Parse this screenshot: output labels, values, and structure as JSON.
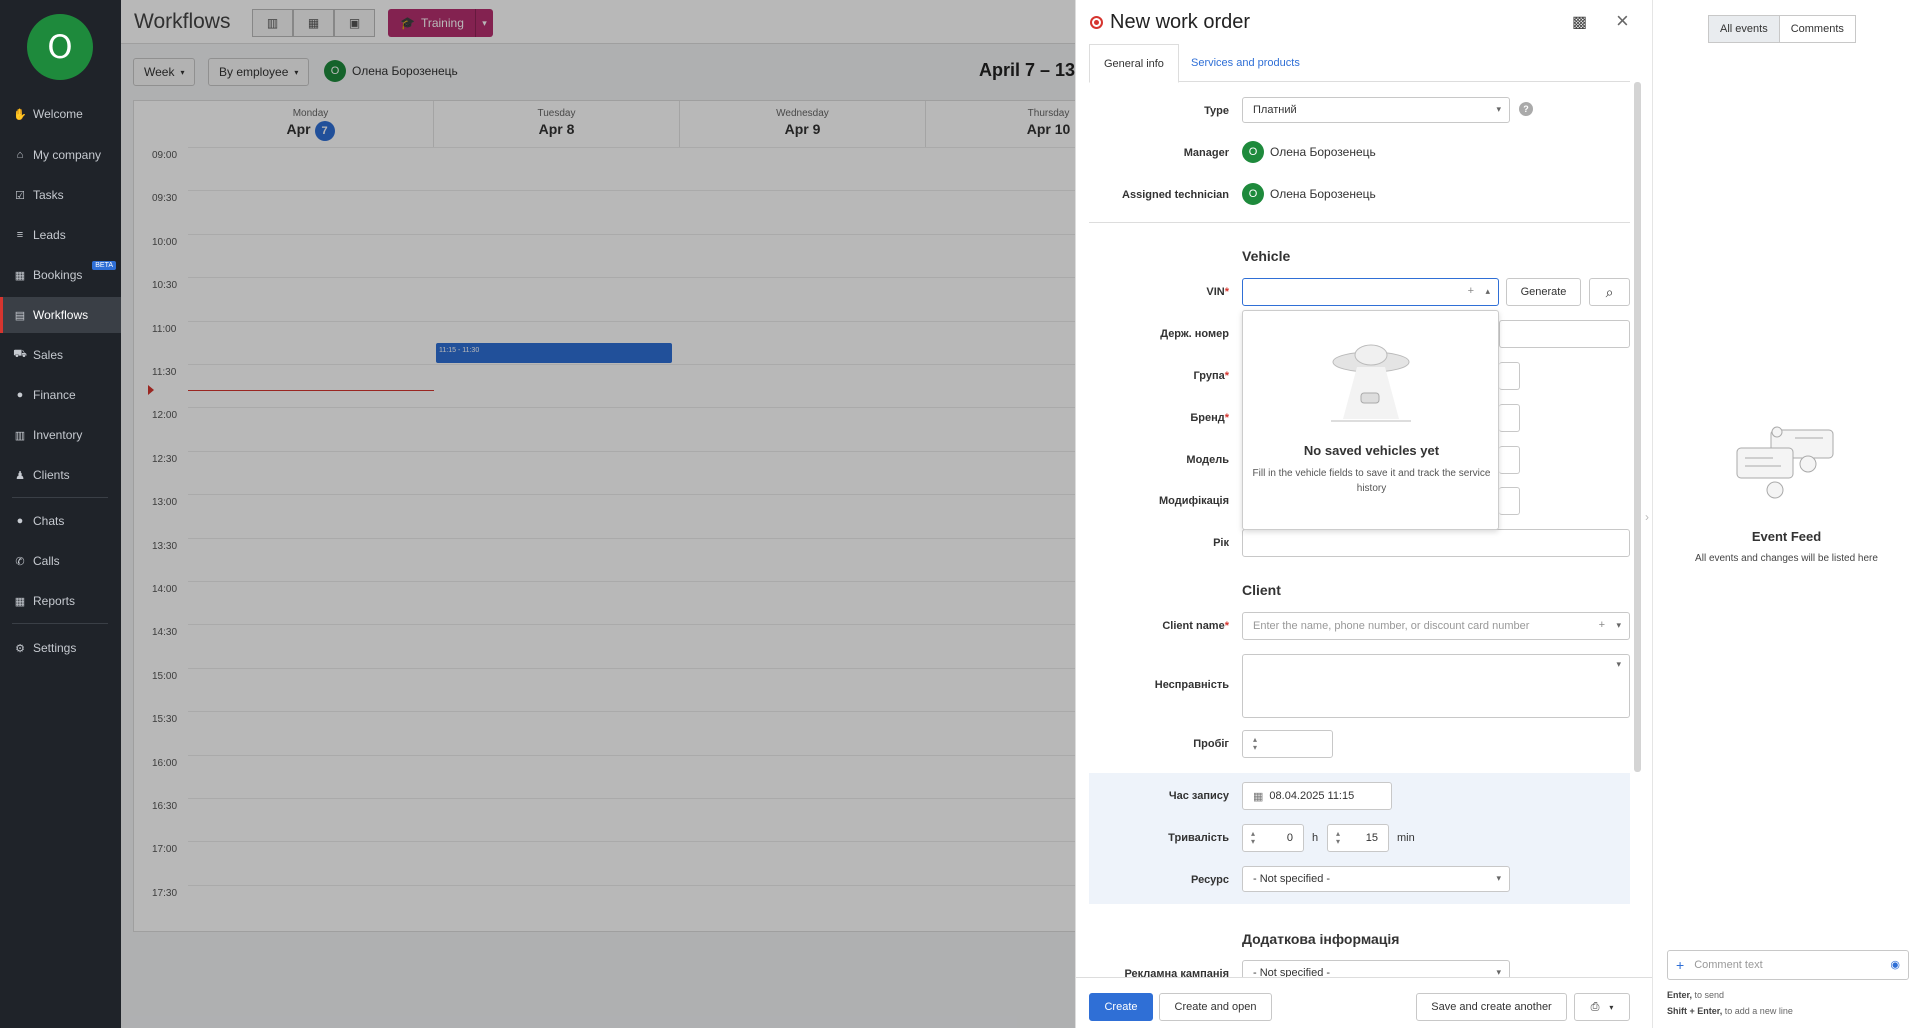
{
  "sidebar": {
    "avatar_letter": "O",
    "items": [
      {
        "label": "Welcome",
        "icon": "wave-hand-icon"
      },
      {
        "label": "My company",
        "icon": "home-icon"
      },
      {
        "label": "Tasks",
        "icon": "clipboard-check-icon"
      },
      {
        "label": "Leads",
        "icon": "funnel-icon"
      },
      {
        "label": "Bookings",
        "icon": "calendar-icon",
        "badge": "BETA"
      },
      {
        "label": "Workflows",
        "icon": "workflow-icon"
      },
      {
        "label": "Sales",
        "icon": "cart-icon"
      },
      {
        "label": "Finance",
        "icon": "coin-icon"
      },
      {
        "label": "Inventory",
        "icon": "warehouse-icon"
      },
      {
        "label": "Clients",
        "icon": "users-icon"
      },
      {
        "label": "Chats",
        "icon": "chat-icon"
      },
      {
        "label": "Calls",
        "icon": "phone-icon"
      },
      {
        "label": "Reports",
        "icon": "report-icon"
      },
      {
        "label": "Settings",
        "icon": "gear-icon"
      }
    ],
    "active_item": "Workflows"
  },
  "topbar": {
    "title": "Workflows",
    "training_label": "Training"
  },
  "filters": {
    "period": "Week",
    "group_by": "By employee",
    "employee_initial": "O",
    "employee_name": "Олена Борозенець",
    "range_title": "April 7 – 13,"
  },
  "calendar": {
    "days": [
      {
        "name": "Monday",
        "month": "Apr",
        "day": "7",
        "today": true
      },
      {
        "name": "Tuesday",
        "month": "Apr",
        "day": "8",
        "today": false
      },
      {
        "name": "Wednesday",
        "month": "Apr",
        "day": "9",
        "today": false
      },
      {
        "name": "Thursday",
        "month": "Apr",
        "day": "10",
        "today": false
      }
    ],
    "times": [
      "09:00",
      "09:30",
      "10:00",
      "10:30",
      "11:00",
      "11:30",
      "12:00",
      "12:30",
      "13:00",
      "13:30",
      "14:00",
      "14:30",
      "15:00",
      "15:30",
      "16:00",
      "16:30",
      "17:00",
      "17:30"
    ],
    "event_label": "11:15 - 11:30"
  },
  "drawer": {
    "title": "New work order",
    "tabs": [
      "General info",
      "Services and products"
    ],
    "type_label": "Type",
    "type_value": "Платний",
    "manager_label": "Manager",
    "manager_initial": "O",
    "manager_name": "Олена Борозенець",
    "technician_label": "Assigned technician",
    "technician_initial": "O",
    "technician_name": "Олена Борозенець",
    "vehicle_section": "Vehicle",
    "vin_label": "VIN",
    "generate_label": "Generate",
    "plate_label": "Держ. номер",
    "group_label": "Група",
    "brand_label": "Бренд",
    "model_label": "Модель",
    "modification_label": "Модифікація",
    "year_label": "Рік",
    "vin_popup_title": "No saved vehicles yet",
    "vin_popup_text": "Fill in the vehicle fields to save it and track the service history",
    "client_section": "Client",
    "client_name_label": "Client name",
    "client_name_placeholder": "Enter the name, phone number, or discount card number",
    "fault_label": "Несправність",
    "mileage_label": "Пробіг",
    "booking_time_label": "Час запису",
    "booking_time_value": "08.04.2025 11:15",
    "duration_label": "Тривалість",
    "duration_hours": "0",
    "duration_h_unit": "h",
    "duration_minutes": "15",
    "duration_min_unit": "min",
    "resource_label": "Ресурс",
    "resource_value": "- Not specified -",
    "extra_section": "Додаткова інформація",
    "campaign_label": "Рекламна кампанія",
    "campaign_value": "- Not specified -",
    "footer": {
      "create": "Create",
      "create_open": "Create and open",
      "save_another": "Save and create another"
    }
  },
  "feed": {
    "tabs": [
      "All events",
      "Comments"
    ],
    "active_tab": "All events",
    "empty_title": "Event Feed",
    "empty_text": "All events and changes will be listed here",
    "comment_placeholder": "Comment text",
    "hint_enter_key": "Enter,",
    "hint_enter_text": "to send",
    "hint_shift_key": "Shift + Enter,",
    "hint_shift_text": "to add a new line"
  },
  "colors": {
    "accent": "#2f6fd6",
    "training": "#b6306f",
    "avatar": "#1e8a3c",
    "required": "#d6352f",
    "sidebar_bg": "#1f2329"
  }
}
